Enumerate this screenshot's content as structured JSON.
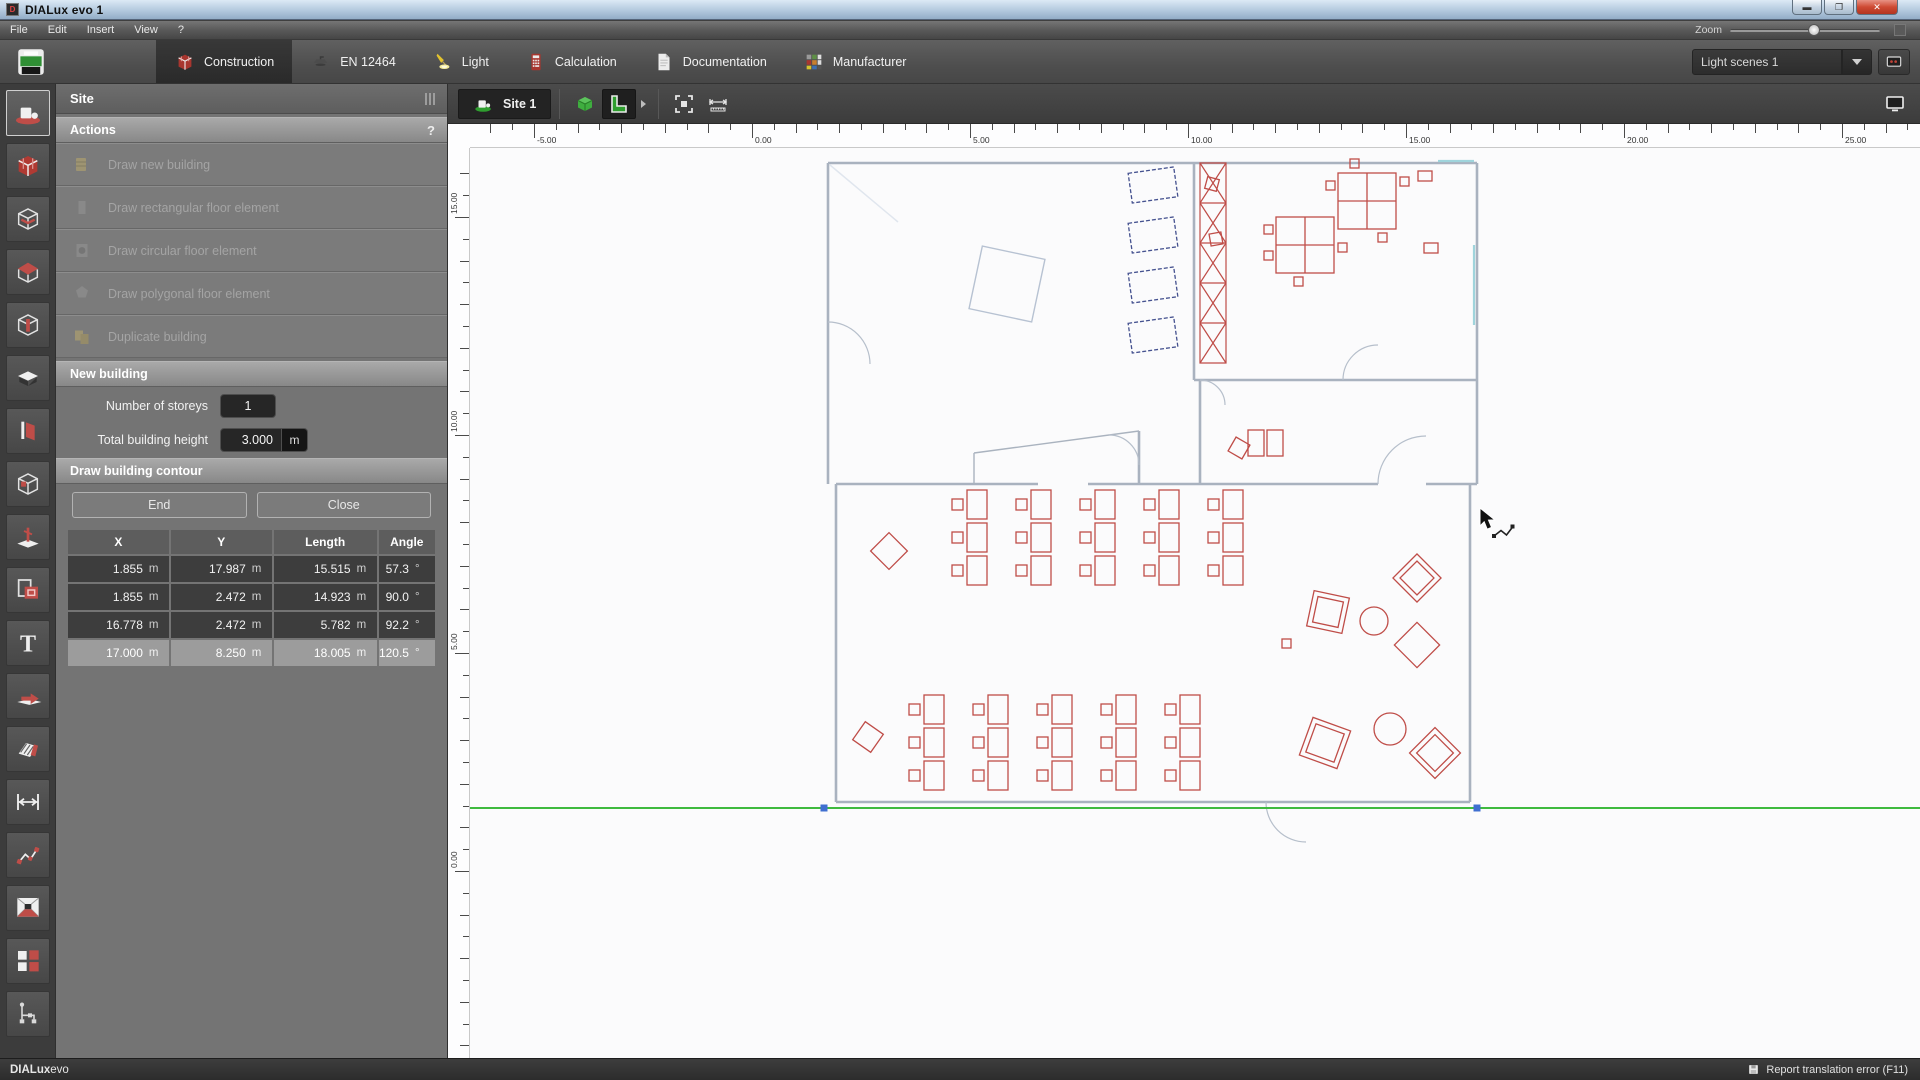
{
  "window": {
    "title": "DIALux evo 1"
  },
  "menubar": {
    "items": [
      "File",
      "Edit",
      "Insert",
      "View",
      "?"
    ],
    "zoom_label": "Zoom"
  },
  "toolbar": {
    "save_icon": "save-icon",
    "tabs": [
      {
        "label": "Construction",
        "icon": "construction-icon",
        "active": true
      },
      {
        "label": "EN 12464",
        "icon": "en12464-icon",
        "active": false
      },
      {
        "label": "Light",
        "icon": "light-icon",
        "active": false
      },
      {
        "label": "Calculation",
        "icon": "calculation-icon",
        "active": false
      },
      {
        "label": "Documentation",
        "icon": "documentation-icon",
        "active": false
      },
      {
        "label": "Manufacturer",
        "icon": "manufacturer-icon",
        "active": false
      }
    ],
    "light_scenes_value": "Light scenes 1",
    "scenes_button_icon": "scenes-icon"
  },
  "tool_sidebar": {
    "tools": [
      {
        "name": "site",
        "icon": "site-icon",
        "selected": true
      },
      {
        "name": "building",
        "icon": "building-icon",
        "selected": false
      },
      {
        "name": "storey",
        "icon": "storey-icon",
        "selected": false
      },
      {
        "name": "roof",
        "icon": "roof-icon",
        "selected": false
      },
      {
        "name": "column",
        "icon": "column-icon",
        "selected": false
      },
      {
        "name": "ceiling",
        "icon": "ceiling-icon",
        "selected": false
      },
      {
        "name": "door",
        "icon": "door-icon",
        "selected": false
      },
      {
        "name": "window",
        "icon": "window-icon",
        "selected": false
      },
      {
        "name": "marker",
        "icon": "marker-icon",
        "selected": false
      },
      {
        "name": "cutout",
        "icon": "cutout-icon",
        "selected": false
      },
      {
        "name": "text",
        "icon": "text-icon",
        "selected": false
      },
      {
        "name": "arrange",
        "icon": "arrange-icon",
        "selected": false
      },
      {
        "name": "material",
        "icon": "material-icon",
        "selected": false
      },
      {
        "name": "dimension",
        "icon": "dimension-icon",
        "selected": false
      },
      {
        "name": "measure-line",
        "icon": "measure-line-icon",
        "selected": false
      },
      {
        "name": "room-view",
        "icon": "room-view-icon",
        "selected": false
      },
      {
        "name": "layout",
        "icon": "layout-icon",
        "selected": false
      },
      {
        "name": "hierarchy",
        "icon": "hierarchy-icon",
        "selected": false
      }
    ]
  },
  "panel": {
    "title": "Site",
    "actions": {
      "title": "Actions",
      "help": "?",
      "items": [
        {
          "label": "Draw new building",
          "icon": "draw-building-icon",
          "enabled": false
        },
        {
          "label": "Draw rectangular floor element",
          "icon": "rect-floor-icon",
          "enabled": false
        },
        {
          "label": "Draw circular floor element",
          "icon": "circle-floor-icon",
          "enabled": false
        },
        {
          "label": "Draw polygonal floor element",
          "icon": "poly-floor-icon",
          "enabled": false
        },
        {
          "label": "Duplicate building",
          "icon": "duplicate-icon",
          "enabled": false
        }
      ]
    },
    "new_building": {
      "title": "New building",
      "fields": [
        {
          "label": "Number of storeys",
          "value": "1",
          "unit": ""
        },
        {
          "label": "Total building height",
          "value": "3.000",
          "unit": "m"
        }
      ]
    },
    "contour": {
      "title": "Draw building contour",
      "buttons": [
        "End",
        "Close"
      ],
      "table": {
        "columns": [
          "X",
          "Y",
          "Length",
          "Angle"
        ],
        "units": [
          "m",
          "m",
          "m",
          "°"
        ],
        "rows": [
          {
            "x": "1.855",
            "y": "17.987",
            "length": "15.515",
            "angle": "57.3",
            "highlight": false
          },
          {
            "x": "1.855",
            "y": "2.472",
            "length": "14.923",
            "angle": "90.0",
            "highlight": false
          },
          {
            "x": "16.778",
            "y": "2.472",
            "length": "5.782",
            "angle": "92.2",
            "highlight": false
          },
          {
            "x": "17.000",
            "y": "8.250",
            "length": "18.005",
            "angle": "120.5",
            "highlight": true
          }
        ]
      }
    }
  },
  "canvas": {
    "view_tab": "Site 1",
    "view_tab_icon": "site-tab-icon",
    "view_buttons": [
      "cube-3d-icon",
      "floor-plan-icon"
    ],
    "fit_icon": "fit-view-icon",
    "measure_icon": "measure-tool-icon",
    "monitor_icon": "monitor-icon",
    "ruler_h_labels": [
      "-5.00",
      "0.00",
      "5.00",
      "10.00",
      "15.00",
      "20.00",
      "25.00"
    ],
    "ruler_v_labels": [
      "15.00",
      "10.00",
      "5.00",
      "0.00"
    ]
  },
  "statusbar": {
    "brand_bold": "DIALux",
    "brand_light": "evo",
    "right_icon": "disk-icon",
    "right_text": "Report translation error (F11)"
  },
  "colors": {
    "accent_green": "#3fae3f",
    "contour_line_green": "#3fba3f",
    "handle_blue": "#3f6fd0",
    "furniture_red": "#bf4d48",
    "wardrobe_blue": "#44518f",
    "close_button_red": "#c4352c",
    "titlebar_blue": "#b3c9de"
  }
}
